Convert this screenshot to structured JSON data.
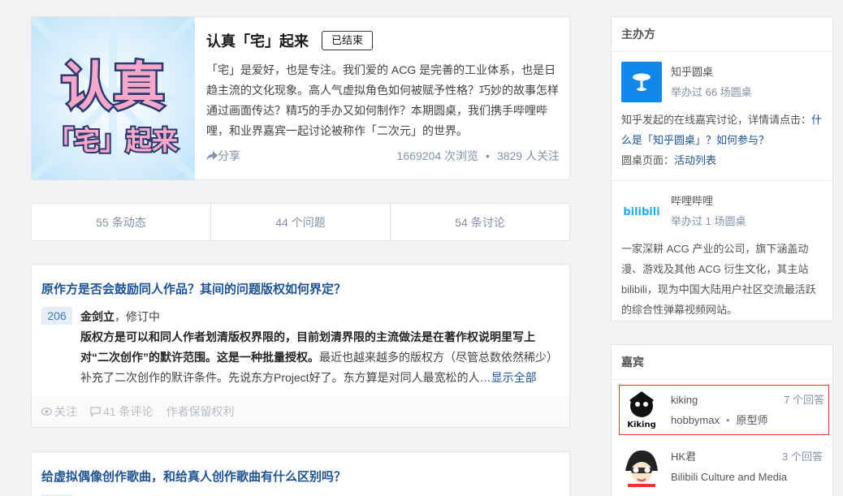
{
  "hero": {
    "title": "认真「宅」起来",
    "status": "已结束",
    "description": "「宅」是爱好，也是专注。我们爱的 ACG 是完善的工业体系，也是日趋主流的文化现象。高人气虚拟角色如何被赋予性格？巧妙的故事怎样通过画面传达？精巧的手办又如何制作？本期圆桌，我们携手哔哩哔哩，和业界嘉宾一起讨论被称作「二次元」的世界。",
    "share": "分享",
    "views": "1669204 次浏览",
    "followers": "3829 人关注",
    "image_text_line1": "认真",
    "image_text_line2": "「宅」起来"
  },
  "tabs": [
    "55 条动态",
    "44 个问题",
    "54 条讨论"
  ],
  "question1": {
    "title": "原作方是否会鼓励同人作品？其间的问题版权如何界定？",
    "votes": "206",
    "author": "金剑立",
    "author_title": "，修订中",
    "bold_text": "版权方是可以和同人作者划清版权界限的，目前划清界限的主流做法是在著作权说明里写上对“二次创作”的默许范围。这是一种批量授权。",
    "normal_text": "最近也越来越多的版权方（尽管总数依然稀少）补充了二次创作的默许条件。先说东方Project好了。东方算是对同人最宽松的人…",
    "more": "显示全部",
    "follow": "关注",
    "comments": "41 条评论",
    "rights": "作者保留权利"
  },
  "question2": {
    "title": "给虚拟偶像创作歌曲，和给真人创作歌曲有什么区别吗？"
  },
  "organizer": {
    "heading": "主办方",
    "orgs": [
      {
        "name": "知乎圆桌",
        "count": "举办过 66 场圆桌",
        "desc_prefix": "知乎发起的在线嘉宾讨论，详情请点击：",
        "link1": "什么是「知乎圆桌」？如何参与？",
        "desc_mid": "圆桌页面：",
        "link2": "活动列表",
        "logo_color": "#0f88eb"
      },
      {
        "name": "哔哩哔哩",
        "count": "举办过 1 场圆桌",
        "logo_text": "bilibili",
        "desc": "一家深耕 ACG 产业的公司，旗下涵盖动漫、游戏及其他 ACG 衍生文化，其主站 bilibili，现为中国大陆用户社区交流最活跃的综合性弹幕视频网站。",
        "logo_color": "#23ade5"
      }
    ]
  },
  "guests": {
    "heading": "嘉宾",
    "list": [
      {
        "name": "kiking",
        "answers": "7 个回答",
        "org": "hobbymax",
        "title": "原型师",
        "avatar_text": "Kiking"
      },
      {
        "name": "HK君",
        "answers": "3 个回答",
        "org": "Bilibili Culture and Media",
        "title": ""
      }
    ]
  }
}
